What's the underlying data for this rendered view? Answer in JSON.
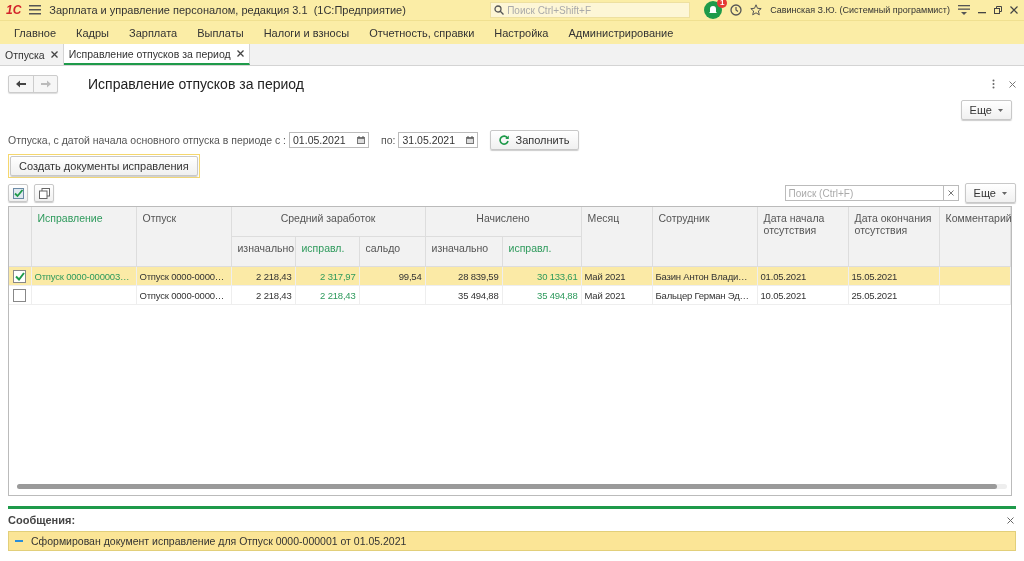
{
  "window": {
    "logo": "1С",
    "title": "Зарплата и управление персоналом, редакция 3.1  (1С:Предприятие)",
    "search_placeholder": "Поиск Ctrl+Shift+F",
    "notifications": "1",
    "user": "Савинская З.Ю. (Системный программист)"
  },
  "menu": [
    "Главное",
    "Кадры",
    "Зарплата",
    "Выплаты",
    "Налоги и взносы",
    "Отчетность, справки",
    "Настройка",
    "Администрирование"
  ],
  "tabs": [
    {
      "label": "Отпуска",
      "selected": false
    },
    {
      "label": "Исправление отпусков за период",
      "selected": true
    }
  ],
  "form": {
    "title": "Исправление отпусков за период",
    "more_button": "Еще",
    "period_label": "Отпуска, с датой начала основного отпуска в периоде с :",
    "date_from": "01.05.2021",
    "to_label": "по:",
    "date_to": "31.05.2021",
    "fill_button": "Заполнить",
    "create_button": "Создать документы исправления",
    "search_placeholder": "Поиск (Ctrl+F)",
    "table_more_button": "Еще"
  },
  "table": {
    "columns": [
      {
        "kind": "checkbox"
      },
      {
        "label": "Исправление",
        "editable": true,
        "kind": "text"
      },
      {
        "label": "Отпуск",
        "editable": false,
        "kind": "text"
      },
      {
        "label": "Средний заработок",
        "colspan": 3,
        "children": [
          {
            "label": "изначально",
            "editable": false,
            "kind": "number"
          },
          {
            "label": "исправл.",
            "editable": true,
            "kind": "number"
          },
          {
            "label": "сальдо",
            "editable": false,
            "kind": "number"
          }
        ]
      },
      {
        "label": "Начислено",
        "colspan": 2,
        "children": [
          {
            "label": "изначально",
            "editable": false,
            "kind": "number"
          },
          {
            "label": "исправл.",
            "editable": true,
            "kind": "number"
          }
        ]
      },
      {
        "label": "Месяц",
        "editable": false,
        "kind": "text"
      },
      {
        "label": "Сотрудник",
        "editable": false,
        "kind": "text"
      },
      {
        "label": "Дата начала отсутствия",
        "editable": false,
        "kind": "text"
      },
      {
        "label": "Дата окончания отсутствия",
        "editable": false,
        "kind": "text"
      },
      {
        "label": "Комментарий",
        "editable": false,
        "kind": "text"
      }
    ],
    "rows": [
      {
        "checked": true,
        "selected": true,
        "cells": [
          "",
          "Отпуск 0000-000003…",
          "Отпуск 0000-0000…",
          "2 218,43",
          "2 317,97",
          "99,54",
          "28 839,59",
          "30 133,61",
          "Май 2021",
          "Базин Антон Влади…",
          "01.05.2021",
          "15.05.2021"
        ]
      },
      {
        "checked": false,
        "selected": false,
        "cells": [
          "",
          "",
          "Отпуск 0000-0000…",
          "2 218,43",
          "2 218,43",
          "",
          "35 494,88",
          "35 494,88",
          "Май 2021",
          "Бальцер Герман Эд…",
          "10.05.2021",
          "25.05.2021"
        ]
      }
    ]
  },
  "messages": {
    "title": "Сообщения:",
    "items": [
      "Сформирован документ исправление для Отпуск 0000-000001 от 01.05.2021"
    ]
  }
}
